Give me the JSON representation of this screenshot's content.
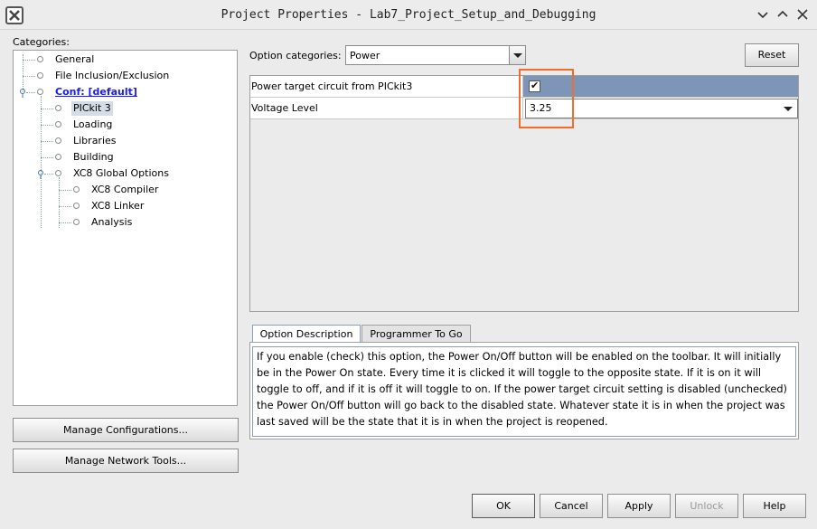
{
  "window": {
    "title": "Project Properties - Lab7_Project_Setup_and_Debugging"
  },
  "categories": {
    "label": "Categories:",
    "items": [
      {
        "label": "General"
      },
      {
        "label": "File Inclusion/Exclusion"
      },
      {
        "label": "Conf: [default]"
      },
      {
        "label": "PICkit 3"
      },
      {
        "label": "Loading"
      },
      {
        "label": "Libraries"
      },
      {
        "label": "Building"
      },
      {
        "label": "XC8 Global Options"
      },
      {
        "label": "XC8 Compiler"
      },
      {
        "label": "XC8 Linker"
      },
      {
        "label": "Analysis"
      }
    ]
  },
  "left_buttons": {
    "manage_configurations": "Manage Configurations...",
    "manage_network_tools": "Manage Network Tools..."
  },
  "options": {
    "category_label": "Option categories:",
    "category_value": "Power",
    "reset_label": "Reset",
    "rows": [
      {
        "name": "Power target circuit from PICkit3",
        "value_checked": "✔"
      },
      {
        "name": "Voltage Level",
        "value": "3.25"
      }
    ]
  },
  "tabs": {
    "option_description": "Option Description",
    "programmer_to_go": "Programmer To Go"
  },
  "description": {
    "text": "If you enable (check) this option, the Power On/Off button will be enabled on the toolbar. It will initially be in the Power On state. Every time it is clicked it will toggle to the opposite state. If it is on it will toggle to off, and if it is off it will toggle to on. If the power target circuit setting is disabled (unchecked) the Power On/Off button will go back to the disabled state. Whatever state it is in when the project was last saved will be the state that it is in when the project is reopened."
  },
  "footer_buttons": {
    "ok": "OK",
    "cancel": "Cancel",
    "apply": "Apply",
    "unlock": "Unlock",
    "help": "Help"
  },
  "colors": {
    "highlight": "#ee6f2d",
    "link": "#1a1aff"
  }
}
